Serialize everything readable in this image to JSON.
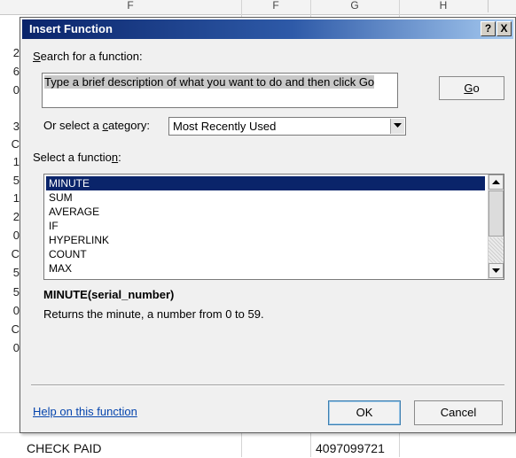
{
  "spreadsheet": {
    "column_headers": [
      "F",
      "F",
      "G",
      "H"
    ],
    "row_fragments": [
      "2",
      "6",
      "0",
      "3",
      "C",
      "1",
      "5",
      "1",
      "2",
      "0",
      "C",
      "5",
      "5",
      "0",
      "C",
      "0"
    ],
    "bottom_row": {
      "left_text": "CHECK PAID",
      "right_text": "4097099721"
    }
  },
  "dialog": {
    "title": "Insert Function",
    "help_glyph": "?",
    "close_glyph": "X",
    "search_label_prefix": "",
    "search_label_accel": "S",
    "search_label_rest": "earch for a function:",
    "search_value": "Type a brief description of what you want to do and then click Go",
    "go_prefix": "",
    "go_accel": "G",
    "go_rest": "o",
    "category_label_prefix": "Or select a ",
    "category_label_accel": "c",
    "category_label_rest": "ategory:",
    "category_value": "Most Recently Used",
    "function_label_prefix": "Select a functio",
    "function_label_accel": "n",
    "function_label_rest": ":",
    "functions": [
      "MINUTE",
      "SUM",
      "AVERAGE",
      "IF",
      "HYPERLINK",
      "COUNT",
      "MAX"
    ],
    "selected_index": 0,
    "function_signature": "MINUTE(serial_number)",
    "function_description": "Returns the minute, a number from 0 to 59.",
    "help_link": "Help on this function",
    "ok_label": "OK",
    "cancel_label": "Cancel"
  },
  "colors": {
    "title_gradient_start": "#0a246a",
    "title_gradient_end": "#a6caf0",
    "selection_bg": "#0a246a",
    "link": "#0645ad",
    "dialog_bg": "#f0f0f0"
  }
}
